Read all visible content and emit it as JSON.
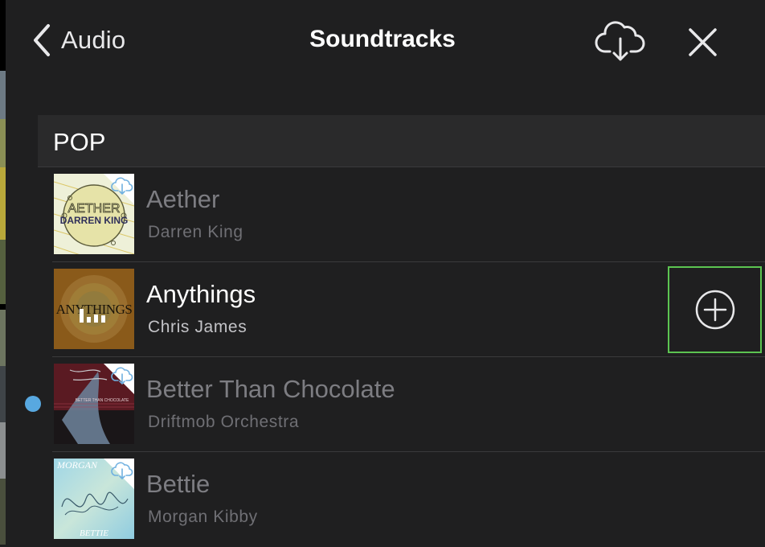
{
  "nav": {
    "back_label": "Audio",
    "title": "Soundtracks",
    "download_icon": "cloud-download-icon",
    "close_icon": "close-icon"
  },
  "section": {
    "label": "POP"
  },
  "tracks": [
    {
      "name": "Aether",
      "artist": "Darren King",
      "state": "not-downloaded",
      "art_text": [
        "AETHER",
        "DARREN KING"
      ]
    },
    {
      "name": "Anythings",
      "artist": "Chris James",
      "state": "playing",
      "art_text": [
        "ANYTHINGS"
      ]
    },
    {
      "name": "Better Than Chocolate",
      "artist": "Driftmob Orchestra",
      "state": "not-downloaded",
      "art_text": [
        "BETTER THAN CHOCOLATE"
      ]
    },
    {
      "name": "Bettie",
      "artist": "Morgan Kibby",
      "state": "not-downloaded",
      "art_text": [
        "MORGAN",
        "BETTIE"
      ]
    }
  ],
  "colors": {
    "accent": "#5cc451",
    "indicator": "#58a8e0",
    "background": "#1f1f20"
  }
}
